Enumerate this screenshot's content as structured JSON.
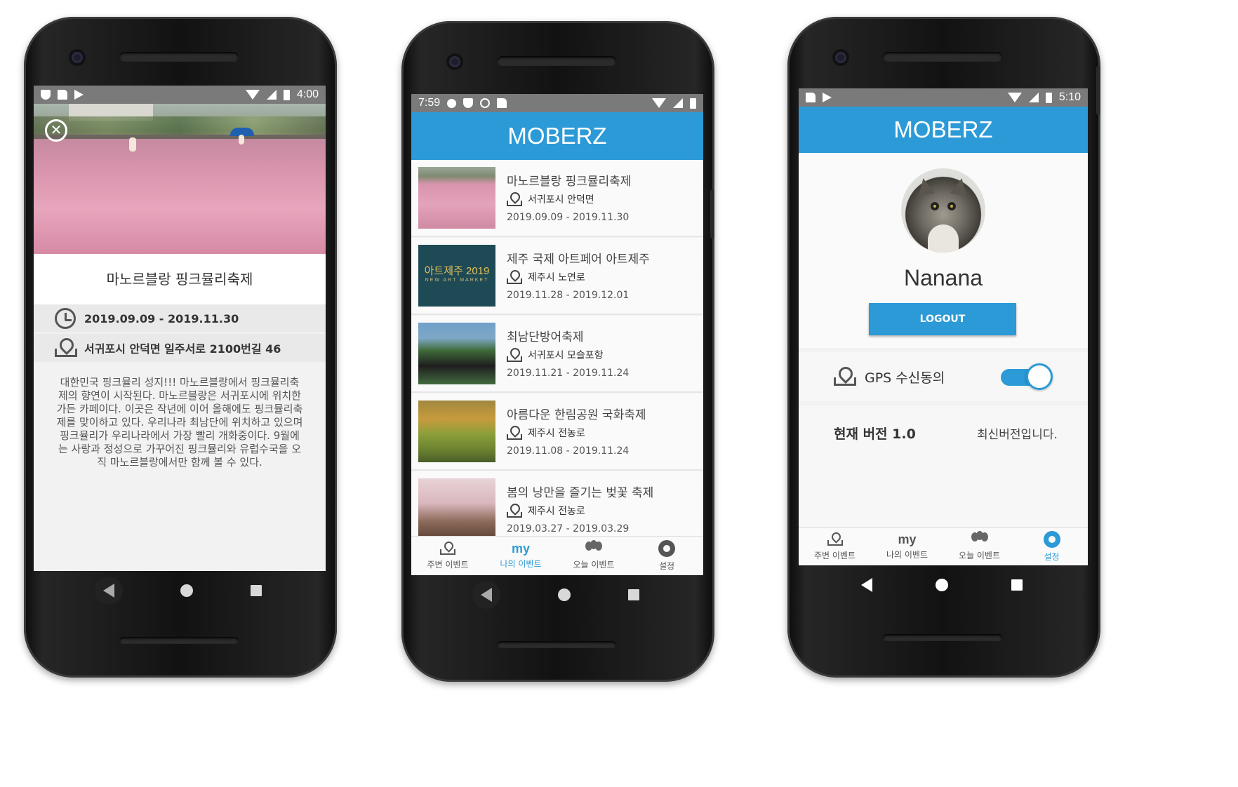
{
  "phone1": {
    "status": {
      "time": "4:00"
    },
    "event_title": "마노르블랑 핑크뮬리축제",
    "date_range": "2019.09.09 - 2019.11.30",
    "address": "서귀포시 안덕면 일주서로 2100번길 46",
    "description_lines": [
      "대한민국 핑크뮬리 성지!!! 마노르블랑에서 핑크뮬리축",
      "제의 향연이 시작된다. 마노르블랑은 서귀포시에 위치한",
      "가든 카페이다. 이곳은 작년에 이어 올해에도 핑크뮬리축",
      "제를 맞이하고 있다. 우리나라 최남단에 위치하고 있으며",
      "핑크뮬리가 우리나라에서 가장 빨리 개화중이다. 9월에",
      "는 사랑과 정성으로 가꾸어진 핑크뮬리와 유럽수국을 오",
      "직 마노르블랑에서만 함께 볼 수 있다."
    ]
  },
  "phone2": {
    "status": {
      "time": "7:59"
    },
    "app_title": "MOBERZ",
    "events": [
      {
        "title": "마노르블랑 핑크뮬리축제",
        "location": "서귀포시 안덕면",
        "dates": "2019.09.09 - 2019.11.30",
        "thumb": "pink"
      },
      {
        "title": "제주 국제 아트페어 아트제주",
        "location": "제주시 노연로",
        "dates": "2019.11.28 - 2019.12.01",
        "thumb": "art",
        "thumb_text": "아트제주 2019",
        "thumb_sub": "NEW ART MARKET"
      },
      {
        "title": "최남단방어축제",
        "location": "서귀포시 모슬포항",
        "dates": "2019.11.21 - 2019.11.24",
        "thumb": "fish"
      },
      {
        "title": "아름다운 한림공원 국화축제",
        "location": "제주시 전농로",
        "dates": "2019.11.08 - 2019.11.24",
        "thumb": "garden"
      },
      {
        "title": "봄의 낭만을 즐기는 벚꽃 축제",
        "location": "제주시 전농로",
        "dates": "2019.03.27 - 2019.03.29",
        "thumb": "cherry"
      }
    ],
    "tabs": [
      {
        "label": "주변 이벤트",
        "icon": "map-pin-icon",
        "active": false
      },
      {
        "label": "나의 이벤트",
        "icon": "my-text-icon",
        "active": true,
        "icon_text": "my"
      },
      {
        "label": "오늘 이벤트",
        "icon": "balloons-icon",
        "active": false
      },
      {
        "label": "설정",
        "icon": "gear-icon",
        "active": false
      }
    ]
  },
  "phone3": {
    "status": {
      "time": "5:10"
    },
    "app_title": "MOBERZ",
    "username": "Nanana",
    "logout_label": "LOGOUT",
    "gps_label": "GPS 수신동의",
    "gps_enabled": true,
    "version_label": "현재 버전 1.0",
    "version_status": "최신버전입니다.",
    "tabs": [
      {
        "label": "주변 이벤트",
        "icon": "map-pin-icon",
        "active": false
      },
      {
        "label": "나의 이벤트",
        "icon": "my-text-icon",
        "active": false,
        "icon_text": "my"
      },
      {
        "label": "오늘 이벤트",
        "icon": "balloons-icon",
        "active": false
      },
      {
        "label": "설정",
        "icon": "gear-icon",
        "active": true
      }
    ]
  },
  "colors": {
    "accent": "#2b9ad6",
    "status_bar": "#7a7a7a"
  }
}
